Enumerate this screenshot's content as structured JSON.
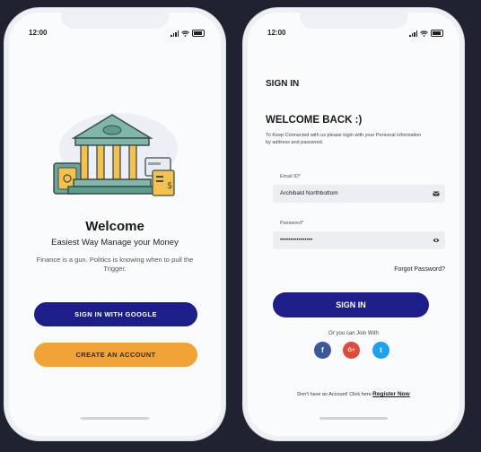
{
  "status_bar": {
    "time": "12:00"
  },
  "welcome_screen": {
    "title": "Welcome",
    "subtitle": "Easiest Way Manage your Money",
    "quote": "Finance is a gun. Politics is knowing when to pull the Trigger.",
    "google_button": "SIGN IN WITH GOOGLE",
    "create_button": "CREATE AN ACCOUNT"
  },
  "signin_screen": {
    "header": "SIGN IN",
    "title": "WELCOME BACK :)",
    "description": "To Keep Connected with us please login with your Personal information by address and password.",
    "email_label": "Email ID*",
    "email_value": "Archibald Northbottom",
    "password_label": "Password*",
    "password_value": "••••••••••••••••",
    "forgot": "Forgot Password?",
    "signin_button": "SIGN IN",
    "or_join": "Or you can Join With",
    "social": {
      "facebook": "f",
      "google": "G+",
      "twitter": "t"
    },
    "register_prompt": "Don't have an Account! Click here",
    "register_link": "Register Now"
  },
  "colors": {
    "primary": "#1d1e8a",
    "accent": "#f0a336",
    "background": "#1f2330"
  }
}
